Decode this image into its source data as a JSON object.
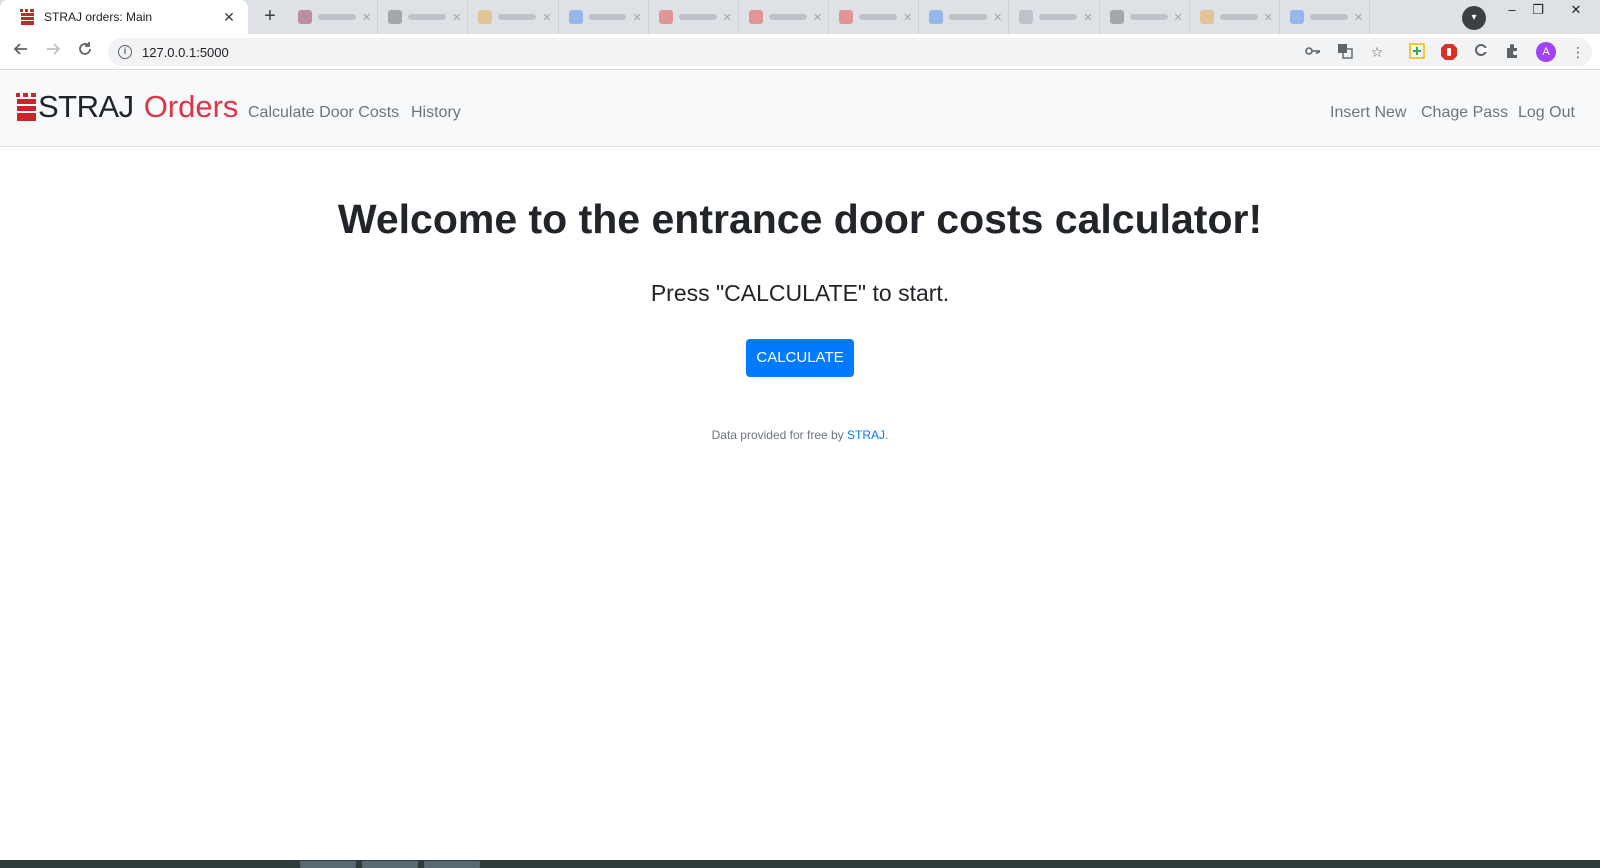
{
  "browser": {
    "active_tab": {
      "title": "STRAJ orders: Main",
      "close": "✕"
    },
    "new_tab": "+",
    "background_tabs": [
      {
        "color": "#8e2d4a"
      },
      {
        "color": "#5f6368"
      },
      {
        "color": "#e8a33d"
      },
      {
        "color": "#4285f4"
      },
      {
        "color": "#e53935"
      },
      {
        "color": "#e53935"
      },
      {
        "color": "#e53935"
      },
      {
        "color": "#4285f4"
      },
      {
        "color": "#9aa0a6"
      },
      {
        "color": "#5f6368"
      },
      {
        "color": "#e8a33d"
      },
      {
        "color": "#4285f4"
      }
    ],
    "window_controls": {
      "minimize": "–",
      "restore": "❐",
      "close": "✕"
    },
    "url": "127.0.0.1:5000",
    "avatar_letter": "A",
    "icons": [
      "back-icon",
      "forward-icon",
      "reload-icon",
      "info-icon",
      "key-icon",
      "translate-icon",
      "star-icon",
      "extension-plus-icon",
      "adblock-icon",
      "extension-icon",
      "puzzle-icon",
      "menu-icon"
    ]
  },
  "navbar": {
    "brand_part1": "STRAJ",
    "brand_part2": "Orders",
    "links_left": [
      "Calculate Door Costs",
      "History"
    ],
    "links_right": [
      "Insert New",
      "Chage Pass",
      "Log Out"
    ]
  },
  "main": {
    "title": "Welcome to the entrance door costs calculator!",
    "subtitle": "Press \"CALCULATE\" to start.",
    "button": "CALCULATE",
    "footer_prefix": "Data provided for free by ",
    "footer_link": "STRAJ",
    "footer_suffix": "."
  },
  "colors": {
    "brand_red": "#dc3545",
    "primary": "#007bff",
    "navbar_bg": "#f8f9fa",
    "text": "#212529",
    "muted": "#6c757d"
  }
}
